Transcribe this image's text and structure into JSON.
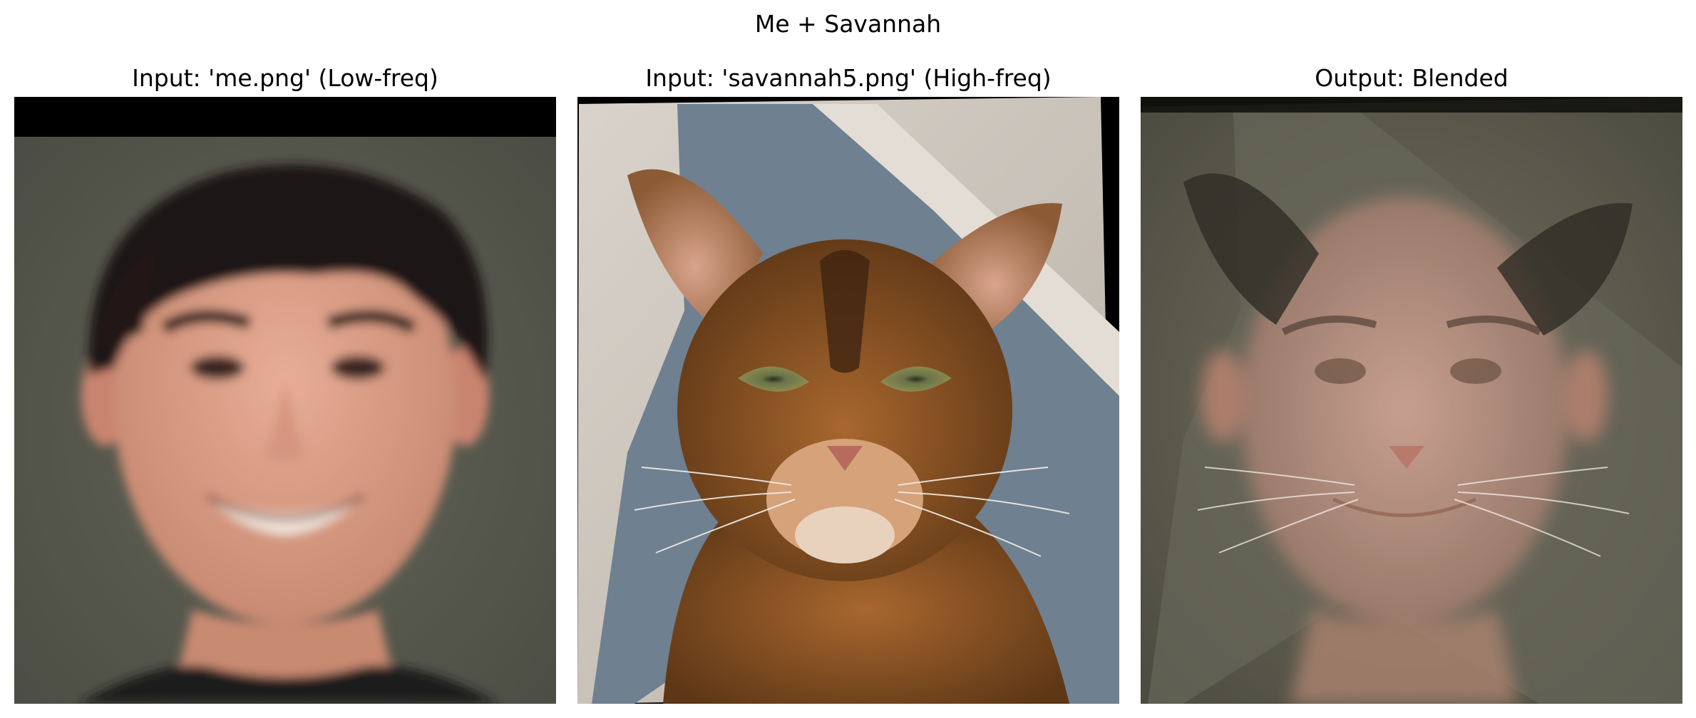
{
  "figure": {
    "title": "Me + Savannah"
  },
  "panels": [
    {
      "title": "Input: 'me.png' (Low-freq)"
    },
    {
      "title": "Input: 'savannah5.png' (High-freq)"
    },
    {
      "title": "Output: Blended"
    }
  ],
  "colors": {
    "background_person": "#5a5b50",
    "hair": "#1e1714",
    "skin": "#d59b86",
    "cat_fur": "#8a5526",
    "cushion": "#cfc8c0",
    "blanket": "#6c7d8c",
    "blend_pink": "#c69a8a"
  }
}
